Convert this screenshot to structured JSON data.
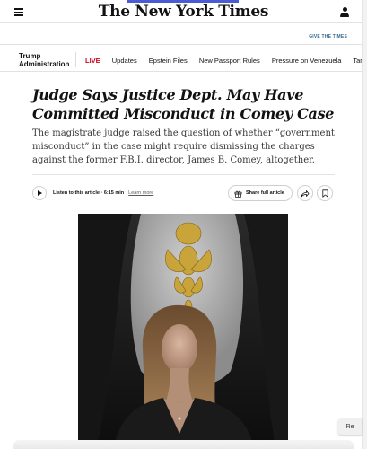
{
  "header": {
    "masthead": "The New York Times",
    "give_link": "GIVE THE TIMES"
  },
  "topic_nav": {
    "title_line1": "Trump",
    "title_line2": "Administration",
    "live_label": "LIVE",
    "links": [
      "Updates",
      "Epstein Files",
      "New Passport Rules",
      "Pressure on Venezuela",
      "Tariff T"
    ]
  },
  "article": {
    "headline": "Judge Says Justice Dept. May Have Committed Misconduct in Comey Case",
    "summary": "The magistrate judge raised the question of whether “government misconduct” in the case might require dismissing the charges against the former F.B.I. director, James B. Comey, altogether."
  },
  "toolbar": {
    "listen_text": "Listen to this article · 6:15 min",
    "learn_more": "Learn more",
    "share_full": "Share full article"
  },
  "side": {
    "read_pill": "Re"
  },
  "colors": {
    "live_red": "#d0021b",
    "link_blue": "#326891",
    "loading_bar": "#4a5bd4"
  }
}
